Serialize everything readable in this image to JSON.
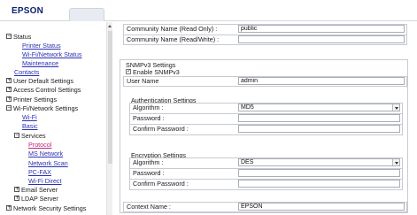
{
  "app": {
    "logo_text": "EPSON"
  },
  "sidebar": {
    "items": [
      {
        "id": "status",
        "label": "Status",
        "toggle": "−"
      },
      {
        "id": "printer-status",
        "label": "Printer Status"
      },
      {
        "id": "wifi-network-status",
        "label": "Wi-Fi/Network Status"
      },
      {
        "id": "maintenance",
        "label": "Maintenance"
      },
      {
        "id": "contacts",
        "label": "Contacts"
      },
      {
        "id": "user-default-settings",
        "label": "User Default Settings",
        "toggle": "+"
      },
      {
        "id": "access-control-settings",
        "label": "Access Control Settings",
        "toggle": "+"
      },
      {
        "id": "printer-settings",
        "label": "Printer Settings",
        "toggle": "+"
      },
      {
        "id": "wifi-network-settings",
        "label": "Wi-Fi/Network Settings",
        "toggle": "−"
      },
      {
        "id": "wifi",
        "label": "Wi-Fi"
      },
      {
        "id": "basic",
        "label": "Basic"
      },
      {
        "id": "services",
        "label": "Services",
        "toggle": "−"
      },
      {
        "id": "protocol",
        "label": "Protocol"
      },
      {
        "id": "ms-network",
        "label": "MS Network"
      },
      {
        "id": "network-scan",
        "label": "Network Scan"
      },
      {
        "id": "pc-fax",
        "label": "PC-FAX"
      },
      {
        "id": "wifi-direct",
        "label": "Wi-Fi Direct"
      },
      {
        "id": "email-server",
        "label": "Email Server",
        "toggle": "+"
      },
      {
        "id": "ldap-server",
        "label": "LDAP Server",
        "toggle": "+"
      },
      {
        "id": "network-security-settings",
        "label": "Network Security Settings",
        "toggle": "+"
      }
    ]
  },
  "form": {
    "community_read_only": {
      "label": "Community Name (Read Only) :",
      "value": "public"
    },
    "community_read_write": {
      "label": "Community Name (Read/Write) :",
      "value": ""
    },
    "snmpv3": {
      "title": "SNMPv3 Settings",
      "enable_label": "Enable SNMPv3",
      "enable_checked": "✓",
      "user_name": {
        "label": "User Name",
        "value": "admin"
      },
      "auth": {
        "title": "Authentication Settings",
        "algorithm": {
          "label": "Algorithm :",
          "value": "MD5"
        },
        "password": {
          "label": "Password :",
          "value": ""
        },
        "confirm": {
          "label": "Confirm Password :",
          "value": ""
        }
      },
      "enc": {
        "title": "Encryption Settings",
        "algorithm": {
          "label": "Algorithm :",
          "value": "DES"
        },
        "password": {
          "label": "Password :",
          "value": ""
        },
        "confirm": {
          "label": "Confirm Password :",
          "value": ""
        }
      },
      "context_name": {
        "label": "Context Name :",
        "value": "EPSON"
      }
    }
  }
}
